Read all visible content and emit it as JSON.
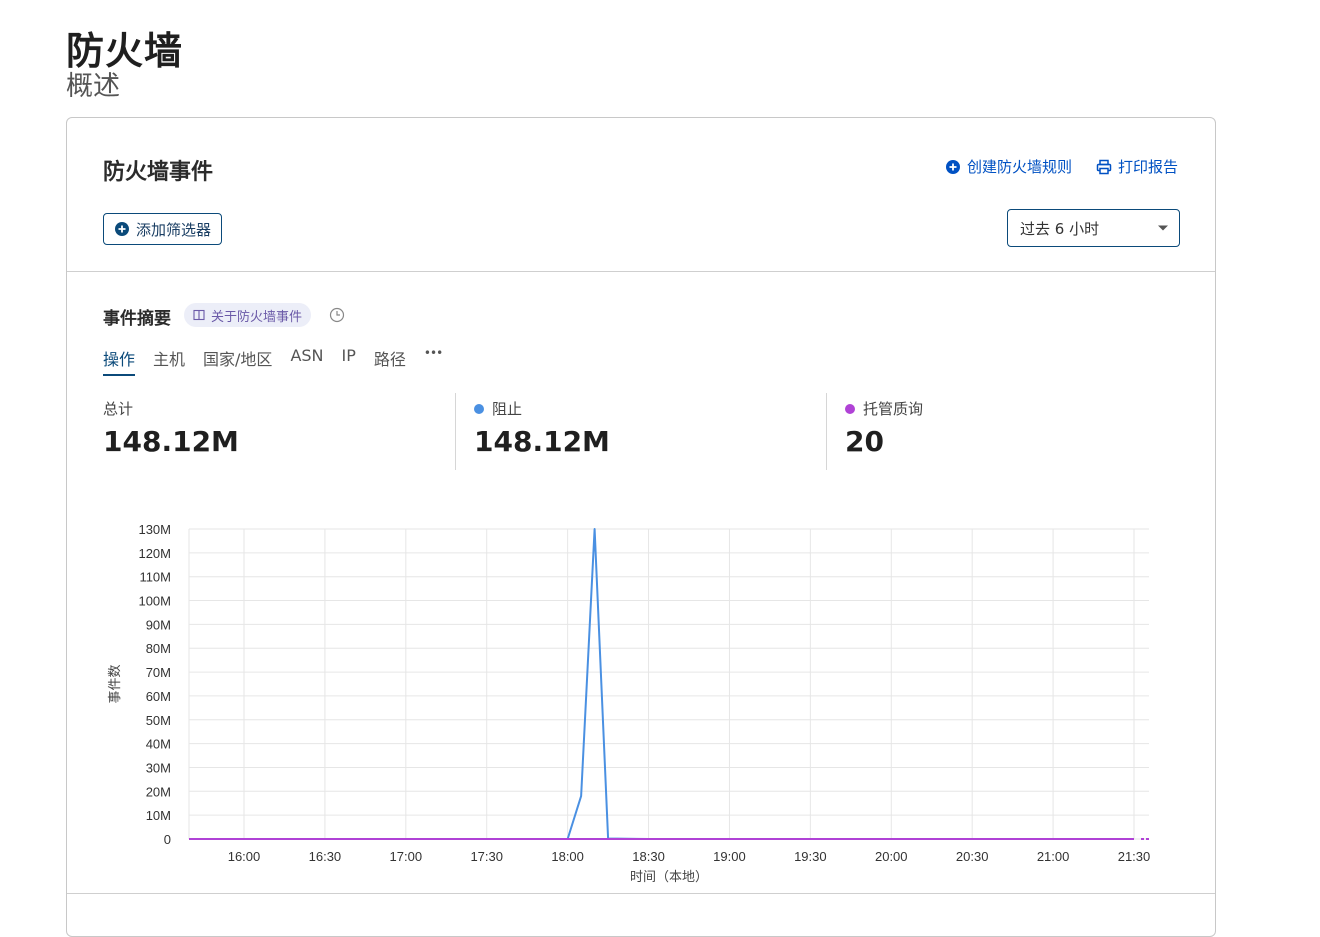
{
  "page": {
    "title": "防火墙",
    "subtitle": "概述"
  },
  "card": {
    "title": "防火墙事件",
    "create_rule_label": "创建防火墙规则",
    "print_label": "打印报告",
    "add_filter_label": "添加筛选器",
    "time_range_value": "过去 6 小时"
  },
  "summary": {
    "title": "事件摘要",
    "about_label": "关于防火墙事件",
    "tabs": [
      "操作",
      "主机",
      "国家/地区",
      "ASN",
      "IP",
      "路径",
      "•••"
    ],
    "active_tab": "操作",
    "metrics": [
      {
        "label": "总计",
        "value": "148.12M"
      },
      {
        "label": "阻止",
        "value": "148.12M",
        "color": "#4a90e2"
      },
      {
        "label": "托管质询",
        "value": "20",
        "color": "#b042d6"
      }
    ]
  },
  "chart_data": {
    "type": "line",
    "ylabel": "事件数",
    "xlabel": "时间（本地）",
    "ylim": [
      0,
      130000000
    ],
    "y_ticks": [
      "0",
      "10M",
      "20M",
      "30M",
      "40M",
      "50M",
      "60M",
      "70M",
      "80M",
      "90M",
      "100M",
      "110M",
      "120M",
      "130M"
    ],
    "x_ticks": [
      "16:00",
      "16:30",
      "17:00",
      "17:30",
      "18:00",
      "18:30",
      "19:00",
      "19:30",
      "20:00",
      "20:30",
      "21:00",
      "21:30"
    ],
    "grid": true,
    "series": [
      {
        "name": "阻止",
        "color": "#4a90e2",
        "points": [
          [
            "15:40",
            0
          ],
          [
            "16:00",
            0
          ],
          [
            "16:30",
            0
          ],
          [
            "17:00",
            0
          ],
          [
            "17:30",
            0
          ],
          [
            "18:00",
            0
          ],
          [
            "18:05",
            18000000
          ],
          [
            "18:10",
            130000000
          ],
          [
            "18:15",
            200000
          ],
          [
            "18:30",
            0
          ],
          [
            "19:00",
            0
          ],
          [
            "19:30",
            0
          ],
          [
            "20:00",
            0
          ],
          [
            "20:30",
            0
          ],
          [
            "21:00",
            0
          ],
          [
            "21:30",
            0
          ]
        ]
      },
      {
        "name": "托管质询",
        "color": "#b042d6",
        "points": [
          [
            "15:40",
            0
          ],
          [
            "16:00",
            0
          ],
          [
            "16:30",
            0
          ],
          [
            "17:00",
            0
          ],
          [
            "17:30",
            0
          ],
          [
            "18:00",
            0
          ],
          [
            "18:30",
            0
          ],
          [
            "19:00",
            0
          ],
          [
            "19:30",
            0
          ],
          [
            "20:00",
            0
          ],
          [
            "20:30",
            0
          ],
          [
            "21:00",
            0
          ],
          [
            "21:30",
            0
          ]
        ]
      }
    ]
  }
}
